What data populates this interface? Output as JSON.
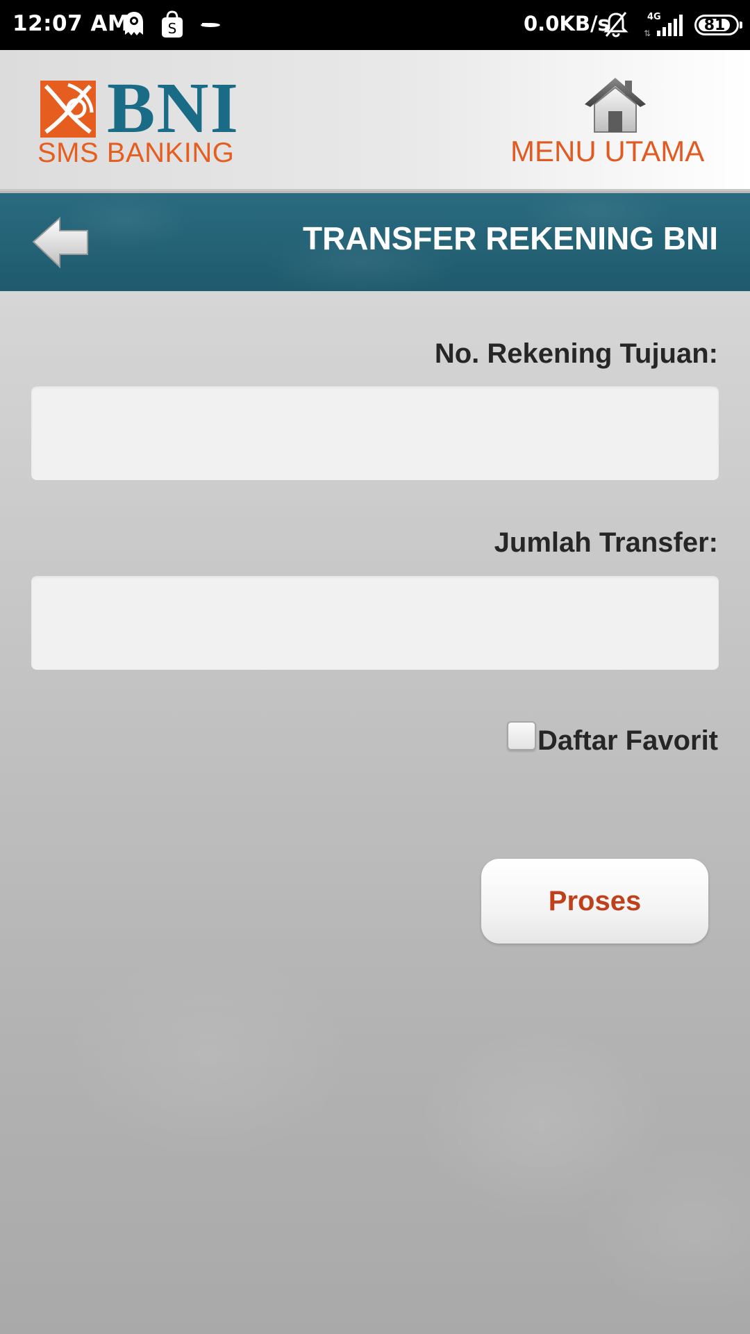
{
  "status_bar": {
    "time": "12:07 AM",
    "network_speed": "0.0KB/s",
    "network_type": "4G",
    "battery": "81",
    "icons": [
      "notification-app-icon",
      "shopping-bag-icon",
      "small-app-icon",
      "mute-bell-icon",
      "signal-icon",
      "battery-icon"
    ]
  },
  "header": {
    "logo_text": "BNI",
    "logo_subtitle": "SMS BANKING",
    "menu_label": "MENU UTAMA",
    "brand_colors": {
      "blue": "#1a6b86",
      "orange": "#e55e1f"
    }
  },
  "titlebar": {
    "title": "TRANSFER REKENING BNI",
    "background": "#226176"
  },
  "form": {
    "account_label": "No. Rekening Tujuan:",
    "account_value": "",
    "amount_label": "Jumlah Transfer:",
    "amount_value": "",
    "favorite_label": "Daftar Favorit",
    "favorite_checked": false,
    "submit_label": "Proses",
    "submit_color": "#c0401c"
  }
}
